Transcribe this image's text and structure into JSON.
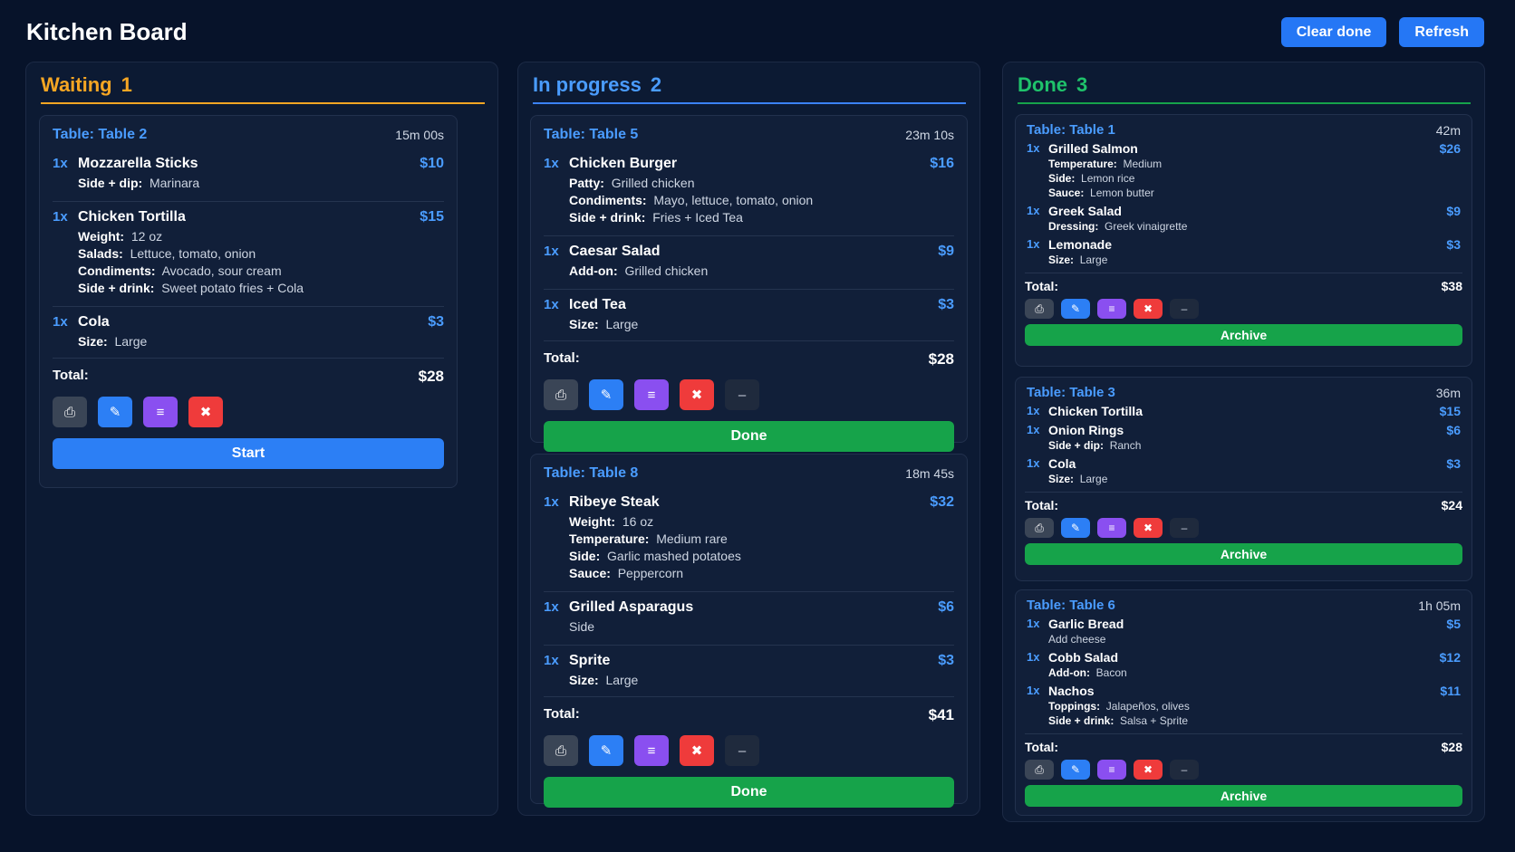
{
  "app": {
    "title": "Kitchen Board"
  },
  "toolbar": {
    "clear_label": "Clear done",
    "refresh_label": "Refresh"
  },
  "columns": {
    "waiting": {
      "title": "Waiting",
      "count": "1"
    },
    "in_progress": {
      "title": "In progress",
      "count": "2"
    },
    "done": {
      "title": "Done",
      "count": "3"
    }
  },
  "labels": {
    "total": "Total:",
    "start": "Start",
    "done": "Done",
    "archive": "Archive"
  },
  "icons": [
    "printer-icon",
    "edit-icon",
    "notes-icon",
    "trash-icon",
    "collapse-icon"
  ],
  "colors": {
    "waiting": "#f6a623",
    "in_progress": "#3b82f6",
    "done": "#16a34a",
    "accent": "#2c7ff5",
    "delete": "#ef3b3b",
    "notes": "#8a4ff0"
  },
  "orders": {
    "w1": {
      "table": "Table: Table 2",
      "elapsed": "15m 00s",
      "total": "$28",
      "items": [
        {
          "qty": "1x",
          "name": "Mozzarella Sticks",
          "price": "$10",
          "mods": [
            {
              "label": "Side + dip:",
              "value": "Marinara"
            }
          ]
        },
        {
          "qty": "1x",
          "name": "Chicken Tortilla",
          "price": "$15",
          "mods": [
            {
              "label": "Weight:",
              "value": "12 oz"
            },
            {
              "label": "Salads:",
              "value": "Lettuce, tomato, onion"
            },
            {
              "label": "Condiments:",
              "value": "Avocado, sour cream"
            },
            {
              "label": "Side + drink:",
              "value": "Sweet potato fries + Cola"
            }
          ]
        },
        {
          "qty": "1x",
          "name": "Cola",
          "price": "$3",
          "mods": [
            {
              "label": "Size:",
              "value": "Large"
            }
          ]
        }
      ]
    },
    "p1": {
      "table": "Table: Table 5",
      "elapsed": "23m 10s",
      "total": "$28",
      "items": [
        {
          "qty": "1x",
          "name": "Chicken Burger",
          "price": "$16",
          "mods": [
            {
              "label": "Patty:",
              "value": "Grilled chicken"
            },
            {
              "label": "Condiments:",
              "value": "Mayo, lettuce, tomato, onion"
            },
            {
              "label": "Side + drink:",
              "value": "Fries + Iced Tea"
            }
          ]
        },
        {
          "qty": "1x",
          "name": "Caesar Salad",
          "price": "$9",
          "mods": [
            {
              "label": "Add-on:",
              "value": "Grilled chicken"
            }
          ]
        },
        {
          "qty": "1x",
          "name": "Iced Tea",
          "price": "$3",
          "mods": [
            {
              "label": "Size:",
              "value": "Large"
            }
          ]
        }
      ]
    },
    "p2": {
      "table": "Table: Table 8",
      "elapsed": "18m 45s",
      "total": "$41",
      "items": [
        {
          "qty": "1x",
          "name": "Ribeye Steak",
          "price": "$32",
          "mods": [
            {
              "label": "Weight:",
              "value": "16 oz"
            },
            {
              "label": "Temperature:",
              "value": "Medium rare"
            },
            {
              "label": "Side:",
              "value": "Garlic mashed potatoes"
            },
            {
              "label": "Sauce:",
              "value": "Peppercorn"
            }
          ]
        },
        {
          "qty": "1x",
          "name": "Grilled Asparagus",
          "price": "$6",
          "mods": [
            {
              "label": "",
              "value": "Side"
            }
          ]
        },
        {
          "qty": "1x",
          "name": "Sprite",
          "price": "$3",
          "mods": [
            {
              "label": "Size:",
              "value": "Large"
            }
          ]
        }
      ]
    },
    "d1": {
      "table": "Table: Table 1",
      "elapsed": "42m",
      "total": "$38",
      "items": [
        {
          "qty": "1x",
          "name": "Grilled Salmon",
          "price": "$26",
          "mods": [
            {
              "label": "Temperature:",
              "value": "Medium"
            },
            {
              "label": "Side:",
              "value": "Lemon rice"
            },
            {
              "label": "Sauce:",
              "value": "Lemon butter"
            }
          ]
        },
        {
          "qty": "1x",
          "name": "Greek Salad",
          "price": "$9",
          "mods": [
            {
              "label": "Dressing:",
              "value": "Greek vinaigrette"
            }
          ]
        },
        {
          "qty": "1x",
          "name": "Lemonade",
          "price": "$3",
          "mods": [
            {
              "label": "Size:",
              "value": "Large"
            }
          ]
        }
      ]
    },
    "d2": {
      "table": "Table: Table 3",
      "elapsed": "36m",
      "total": "$24",
      "items": [
        {
          "qty": "1x",
          "name": "Chicken Tortilla",
          "price": "$15",
          "mods": []
        },
        {
          "qty": "1x",
          "name": "Onion Rings",
          "price": "$6",
          "mods": [
            {
              "label": "Side + dip:",
              "value": "Ranch"
            }
          ]
        },
        {
          "qty": "1x",
          "name": "Cola",
          "price": "$3",
          "mods": [
            {
              "label": "Size:",
              "value": "Large"
            }
          ]
        }
      ]
    },
    "d3": {
      "table": "Table: Table 6",
      "elapsed": "1h 05m",
      "total": "$28",
      "items": [
        {
          "qty": "1x",
          "name": "Garlic Bread",
          "price": "$5",
          "mods": [
            {
              "label": "",
              "value": "Add cheese"
            }
          ]
        },
        {
          "qty": "1x",
          "name": "Cobb Salad",
          "price": "$12",
          "mods": [
            {
              "label": "Add-on:",
              "value": "Bacon"
            }
          ]
        },
        {
          "qty": "1x",
          "name": "Nachos",
          "price": "$11",
          "mods": [
            {
              "label": "Toppings:",
              "value": "Jalapeños, olives"
            },
            {
              "label": "Side + drink:",
              "value": "Salsa + Sprite"
            }
          ]
        }
      ]
    }
  }
}
